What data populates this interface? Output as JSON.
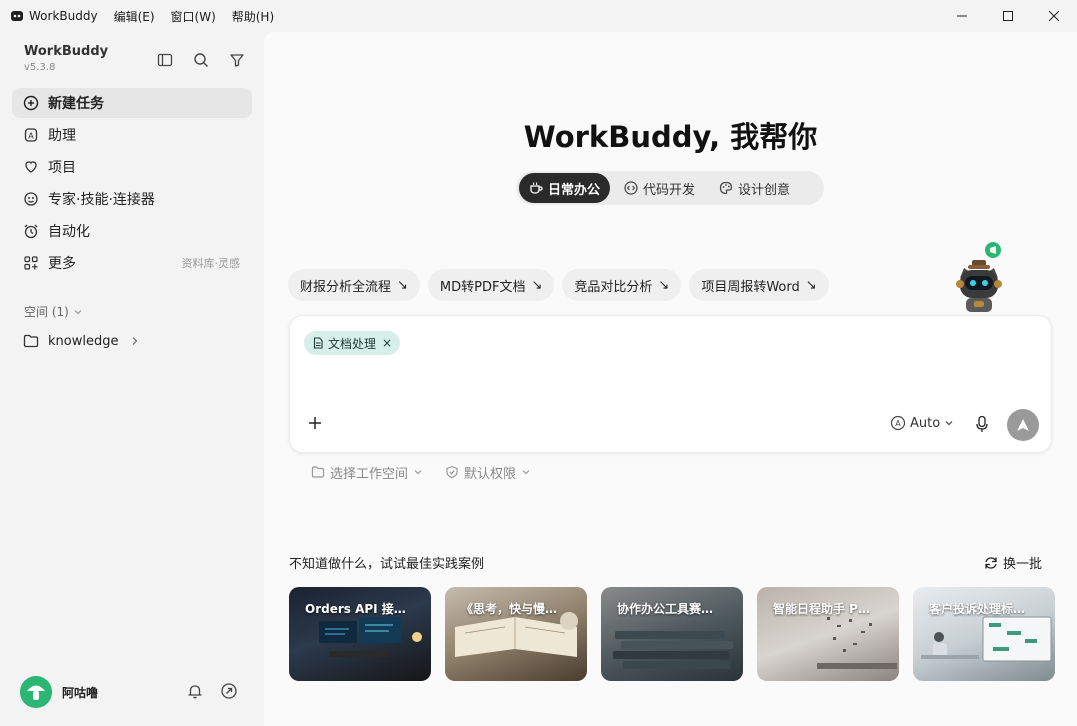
{
  "app": {
    "title": "WorkBuddy",
    "menus": [
      "编辑(E)",
      "窗口(W)",
      "帮助(H)"
    ]
  },
  "sidebar": {
    "brand": "WorkBuddy",
    "version": "v5.3.8",
    "nav": [
      {
        "label": "新建任务",
        "icon": "plus-circle-icon",
        "active": true
      },
      {
        "label": "助理",
        "icon": "assistant-icon"
      },
      {
        "label": "项目",
        "icon": "project-icon"
      },
      {
        "label": "专家·技能·连接器",
        "icon": "expert-icon"
      },
      {
        "label": "自动化",
        "icon": "alarm-clock-icon"
      },
      {
        "label": "更多",
        "icon": "apps-icon",
        "hint": "资料库·灵感"
      }
    ],
    "space_header": "空间 (1)",
    "space_items": [
      {
        "label": "knowledge",
        "icon": "folder-icon"
      }
    ],
    "user": {
      "name": "阿咕噜"
    }
  },
  "main": {
    "title": "WorkBuddy, 我帮你",
    "modes": [
      {
        "label": "日常办公",
        "active": true
      },
      {
        "label": "代码开发"
      },
      {
        "label": "设计创意"
      }
    ],
    "suggestions": [
      {
        "label": "财报分析全流程"
      },
      {
        "label": "MD转PDF文档"
      },
      {
        "label": "竞品对比分析"
      },
      {
        "label": "项目周报转Word"
      }
    ],
    "suggestion_arrow": "↘",
    "composer": {
      "tag": "文档处理",
      "tag_close": "×",
      "model": "Auto"
    },
    "footer": {
      "workspace": "选择工作空间",
      "permission": "默认权限"
    },
    "cases_title": "不知道做什么，试试最佳实践案例",
    "refresh": "换一批",
    "cases": [
      {
        "label": "Orders API 接…"
      },
      {
        "label": "《思考，快与慢…"
      },
      {
        "label": "协作办公工具赛…"
      },
      {
        "label": "智能日程助手 P…"
      },
      {
        "label": "客户投诉处理标…"
      }
    ]
  },
  "colors": {
    "accent_tag": "#d6efe9",
    "active_mode": "#2a2a2a",
    "avatar": "#2bb673",
    "send": "#9a9a9a"
  }
}
